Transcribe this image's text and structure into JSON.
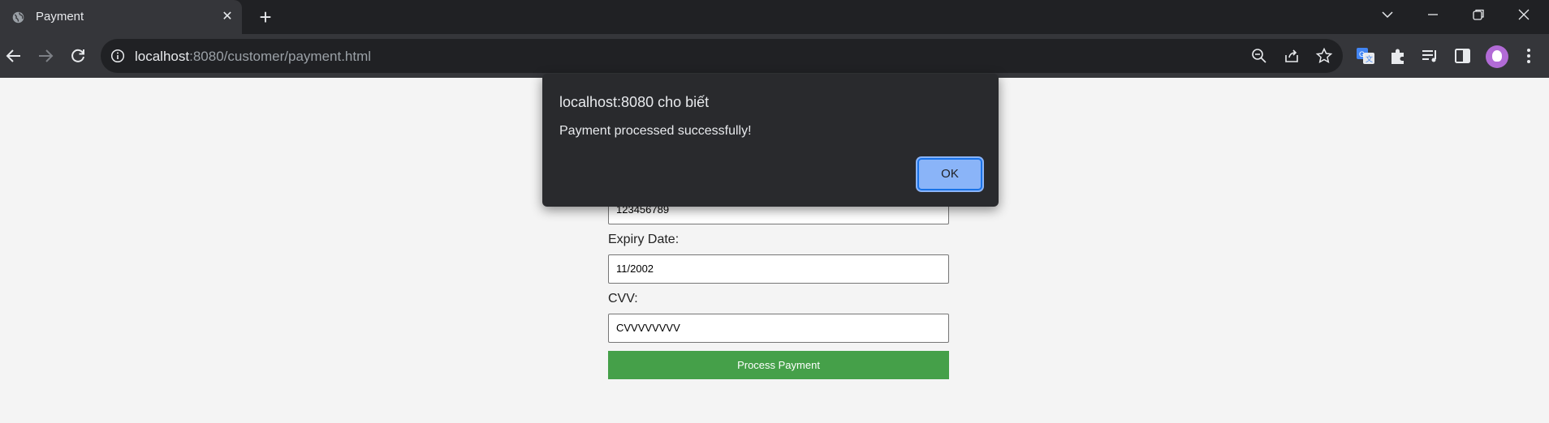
{
  "browser": {
    "tab_title": "Payment",
    "url_host": "localhost",
    "url_rest": ":8080/customer/payment.html"
  },
  "form": {
    "card_number_value": "123456789",
    "expiry_label": "Expiry Date:",
    "expiry_value": "11/2002",
    "cvv_label": "CVV:",
    "cvv_value": "CVVVVVVVV",
    "submit_label": "Process Payment"
  },
  "dialog": {
    "title": "localhost:8080 cho biết",
    "message": "Payment processed successfully!",
    "ok_label": "OK"
  },
  "colors": {
    "page_bg": "#f4f4f4",
    "button_green": "#45a049",
    "chrome_dark": "#202124",
    "ok_blue": "#8ab4f8"
  }
}
